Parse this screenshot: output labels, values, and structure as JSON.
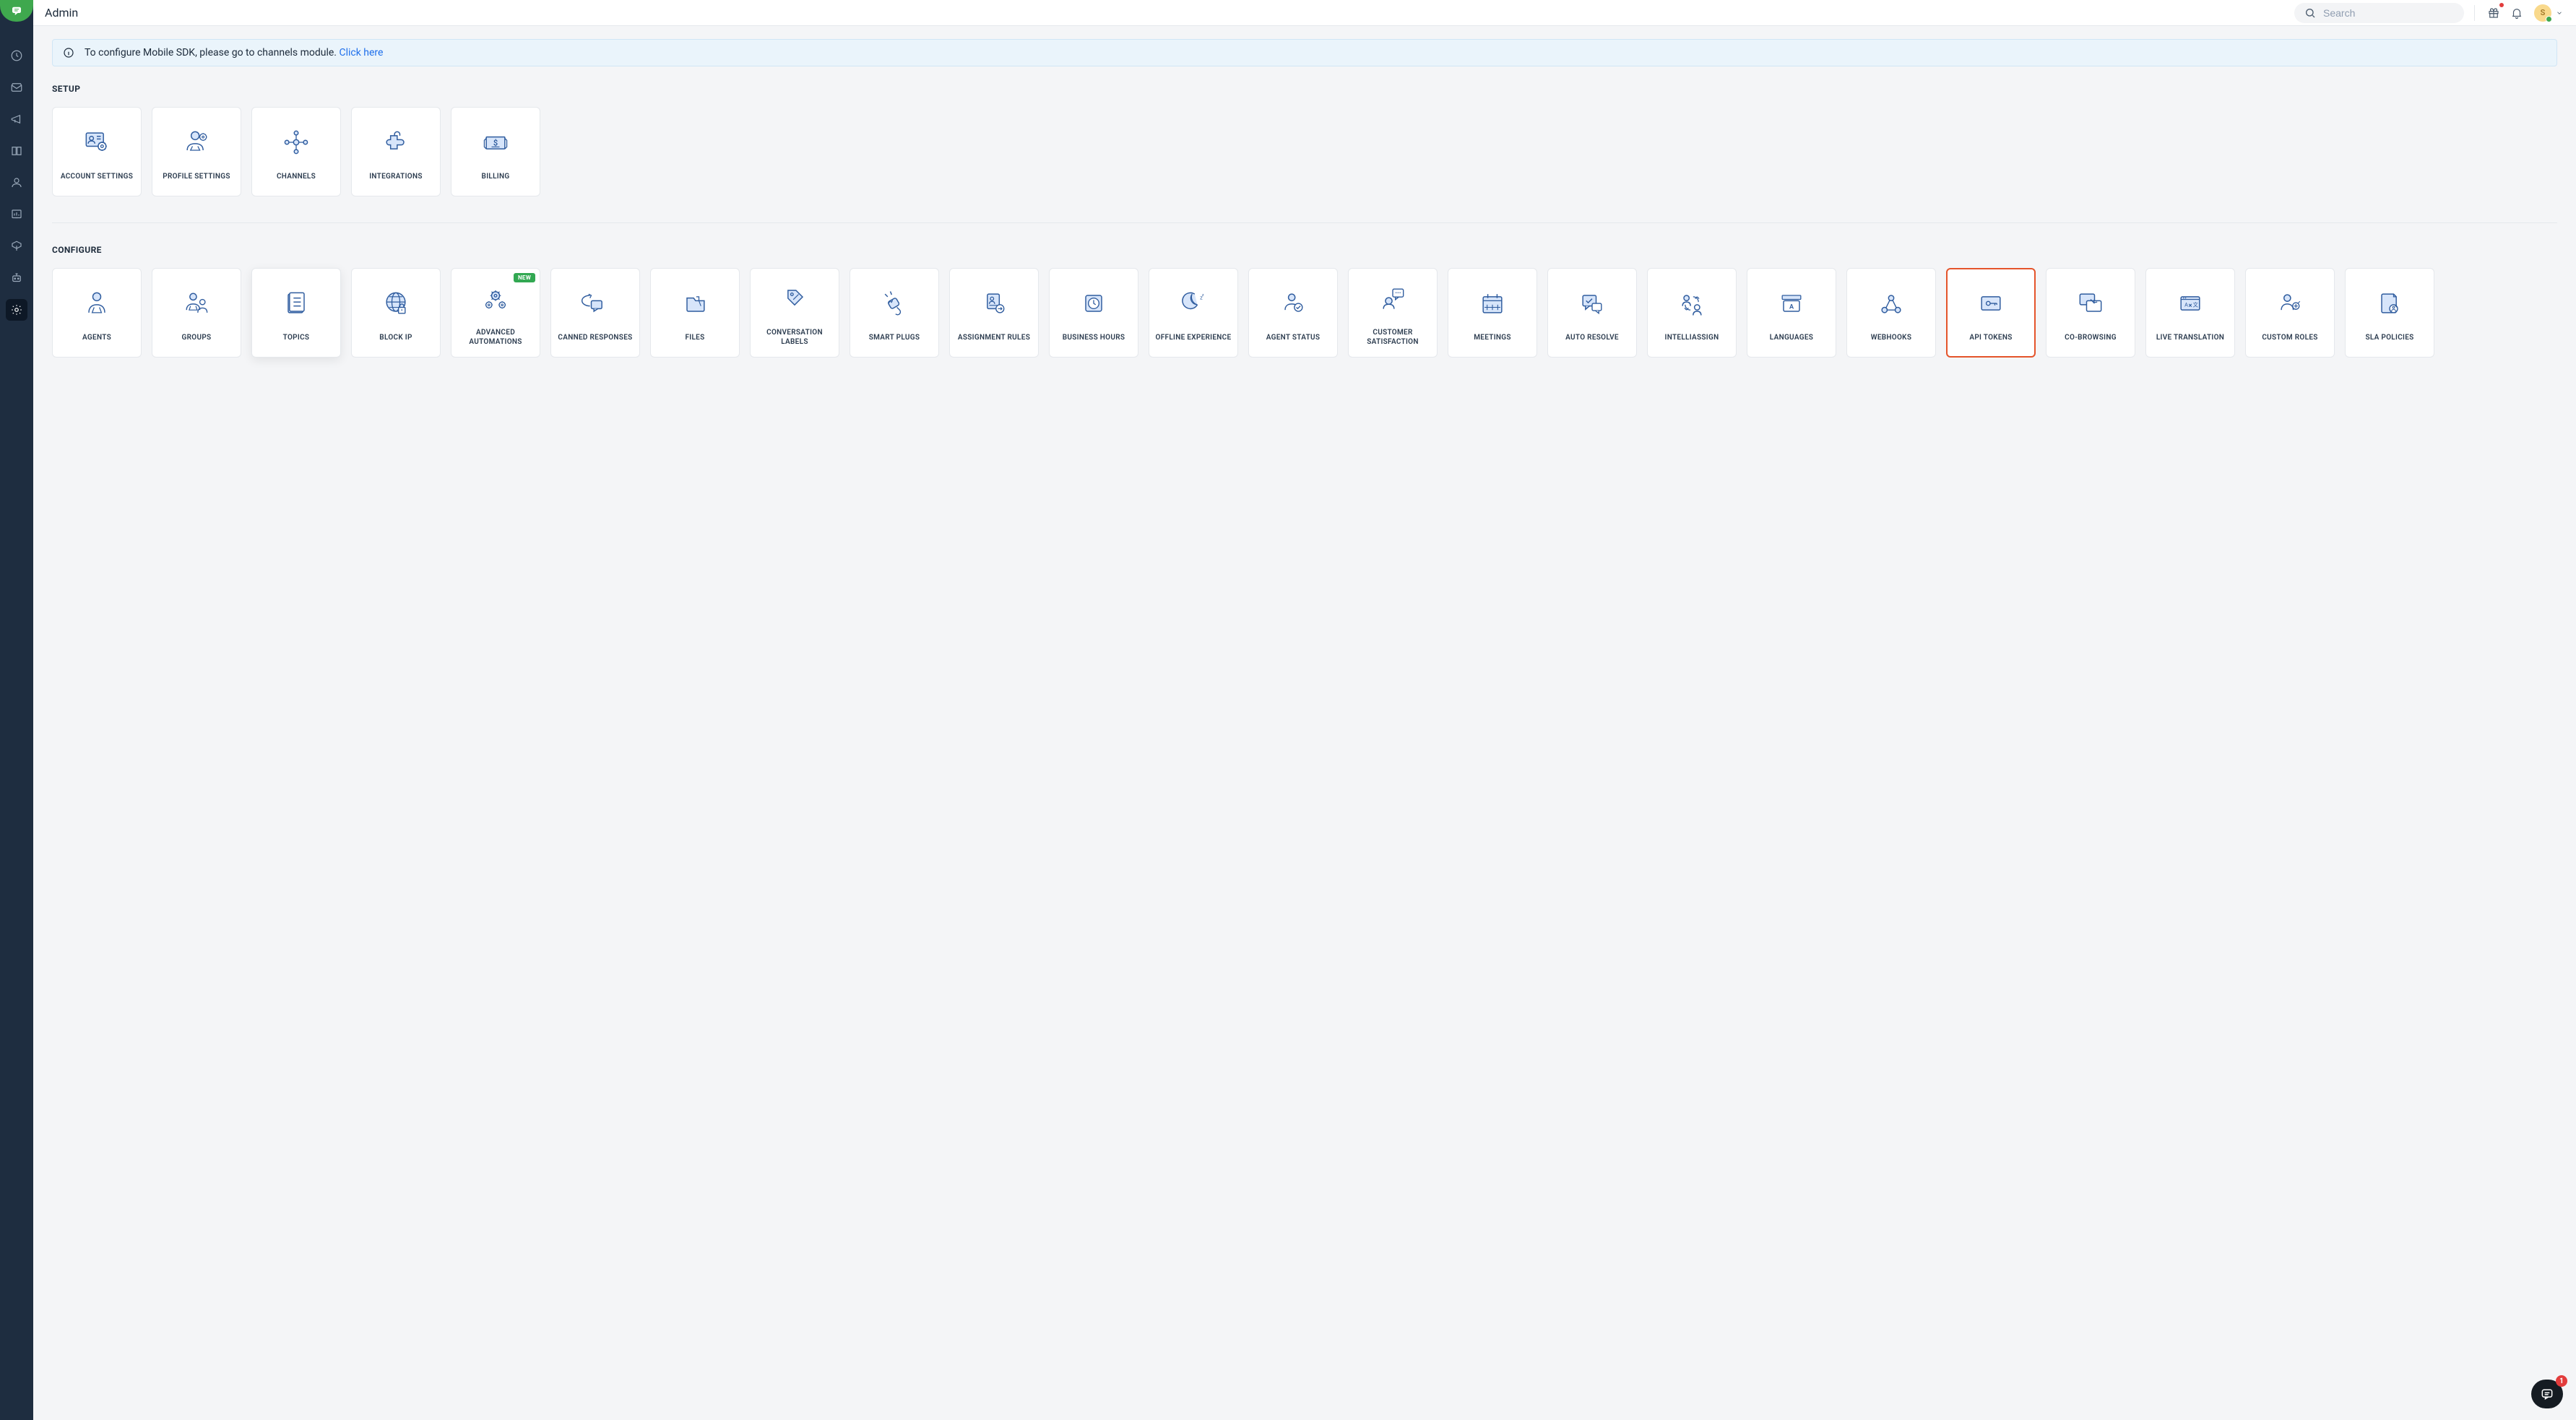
{
  "header": {
    "title": "Admin"
  },
  "search": {
    "placeholder": "Search"
  },
  "avatar": {
    "initial": "S"
  },
  "banner": {
    "text": "To configure Mobile SDK, please go to channels module. ",
    "link_text": "Click here"
  },
  "fab": {
    "count": "1"
  },
  "sections": {
    "setup": {
      "title": "SETUP",
      "cards": [
        {
          "label": "ACCOUNT SETTINGS",
          "icon": "account-settings"
        },
        {
          "label": "PROFILE SETTINGS",
          "icon": "profile-settings"
        },
        {
          "label": "CHANNELS",
          "icon": "channels"
        },
        {
          "label": "INTEGRATIONS",
          "icon": "integrations"
        },
        {
          "label": "BILLING",
          "icon": "billing"
        }
      ]
    },
    "configure": {
      "title": "CONFIGURE",
      "cards": [
        {
          "label": "AGENTS",
          "icon": "agents"
        },
        {
          "label": "GROUPS",
          "icon": "groups"
        },
        {
          "label": "TOPICS",
          "icon": "topics",
          "hovered": true
        },
        {
          "label": "BLOCK IP",
          "icon": "block-ip"
        },
        {
          "label": "ADVANCED AUTOMATIONS",
          "icon": "advanced-automations",
          "badge": "NEW"
        },
        {
          "label": "CANNED RESPONSES",
          "icon": "canned-responses"
        },
        {
          "label": "FILES",
          "icon": "files"
        },
        {
          "label": "CONVERSATION LABELS",
          "icon": "conversation-labels"
        },
        {
          "label": "SMART PLUGS",
          "icon": "smart-plugs"
        },
        {
          "label": "ASSIGNMENT RULES",
          "icon": "assignment-rules"
        },
        {
          "label": "BUSINESS HOURS",
          "icon": "business-hours"
        },
        {
          "label": "OFFLINE EXPERIENCE",
          "icon": "offline-experience"
        },
        {
          "label": "AGENT STATUS",
          "icon": "agent-status"
        },
        {
          "label": "CUSTOMER SATISFACTION",
          "icon": "customer-satisfaction"
        },
        {
          "label": "MEETINGS",
          "icon": "meetings"
        },
        {
          "label": "AUTO RESOLVE",
          "icon": "auto-resolve"
        },
        {
          "label": "INTELLIASSIGN",
          "icon": "intelliassign"
        },
        {
          "label": "LANGUAGES",
          "icon": "languages"
        },
        {
          "label": "WEBHOOKS",
          "icon": "webhooks"
        },
        {
          "label": "API TOKENS",
          "icon": "api-tokens",
          "highlighted": true
        },
        {
          "label": "CO-BROWSING",
          "icon": "co-browsing"
        },
        {
          "label": "LIVE TRANSLATION",
          "icon": "live-translation"
        },
        {
          "label": "CUSTOM ROLES",
          "icon": "custom-roles"
        },
        {
          "label": "SLA POLICIES",
          "icon": "sla-policies"
        }
      ]
    }
  },
  "icons_stroke": "#2f5c9e",
  "icons_fill": "#d7e5fa"
}
